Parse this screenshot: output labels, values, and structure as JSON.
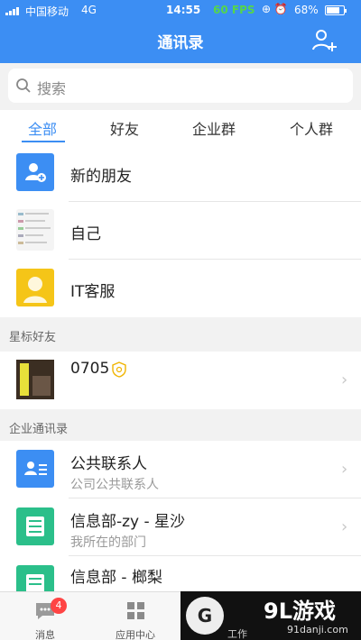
{
  "status_bar": {
    "carrier": "中国移动",
    "network": "4G",
    "time": "14:55",
    "fps": "60 FPS",
    "battery": "68%"
  },
  "header": {
    "title": "通讯录",
    "add_icon": "add-contact-icon"
  },
  "search": {
    "placeholder": "搜索"
  },
  "tabs": [
    "全部",
    "好友",
    "企业群",
    "个人群"
  ],
  "top_items": [
    {
      "label": "新的朋友",
      "icon": "new-friend-icon"
    },
    {
      "label": "自己"
    },
    {
      "label": "IT客服"
    }
  ],
  "starred": {
    "header": "星标好友",
    "items": [
      {
        "label": "0705"
      }
    ]
  },
  "enterprise": {
    "header": "企业通讯录",
    "items": [
      {
        "label": "公共联系人",
        "sub": "公司公共联系人"
      },
      {
        "label": "信息部-zy - 星沙",
        "sub": "我所在的部门"
      },
      {
        "label": "信息部 - 榔梨"
      }
    ]
  },
  "bottom_nav": [
    {
      "label": "消息",
      "badge": "4"
    },
    {
      "label": "应用中心"
    },
    {
      "label": "工作"
    }
  ],
  "watermark": {
    "brand": "9L游戏",
    "sub": "91danji.com"
  },
  "colors": {
    "accent": "#3c8ef3",
    "green": "#2bbf8a"
  }
}
